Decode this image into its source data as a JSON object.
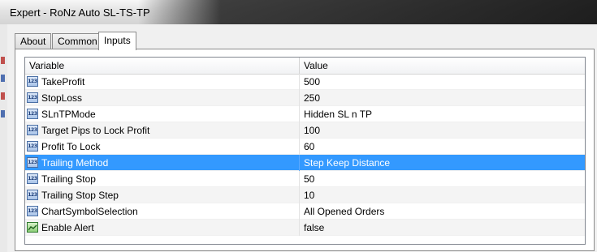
{
  "window": {
    "title": "Expert - RoNz Auto SL-TS-TP"
  },
  "tabs": [
    {
      "label": "About"
    },
    {
      "label": "Common"
    },
    {
      "label": "Inputs"
    }
  ],
  "grid": {
    "headers": {
      "variable": "Variable",
      "value": "Value"
    },
    "rows": [
      {
        "variable": "TakeProfit",
        "value": "500",
        "icon": "number-icon"
      },
      {
        "variable": "StopLoss",
        "value": "250",
        "icon": "number-icon"
      },
      {
        "variable": "SLnTPMode",
        "value": "Hidden SL n TP",
        "icon": "number-icon"
      },
      {
        "variable": "Target Pips to Lock Profit",
        "value": "100",
        "icon": "number-icon"
      },
      {
        "variable": "Profit To Lock",
        "value": "60",
        "icon": "number-icon"
      },
      {
        "variable": "Trailing Method",
        "value": "Step Keep Distance",
        "icon": "number-icon"
      },
      {
        "variable": "Trailing Stop",
        "value": "50",
        "icon": "number-icon"
      },
      {
        "variable": "Trailing Stop Step",
        "value": "10",
        "icon": "number-icon"
      },
      {
        "variable": "ChartSymbolSelection",
        "value": "All Opened Orders",
        "icon": "number-icon"
      },
      {
        "variable": "Enable Alert",
        "value": "false",
        "icon": "boolean-icon"
      }
    ],
    "selected_row": "Trailing Method",
    "number_icon_text": "123"
  },
  "colors": {
    "selection": "#3399ff",
    "alt_row": "#f4f4f4"
  }
}
